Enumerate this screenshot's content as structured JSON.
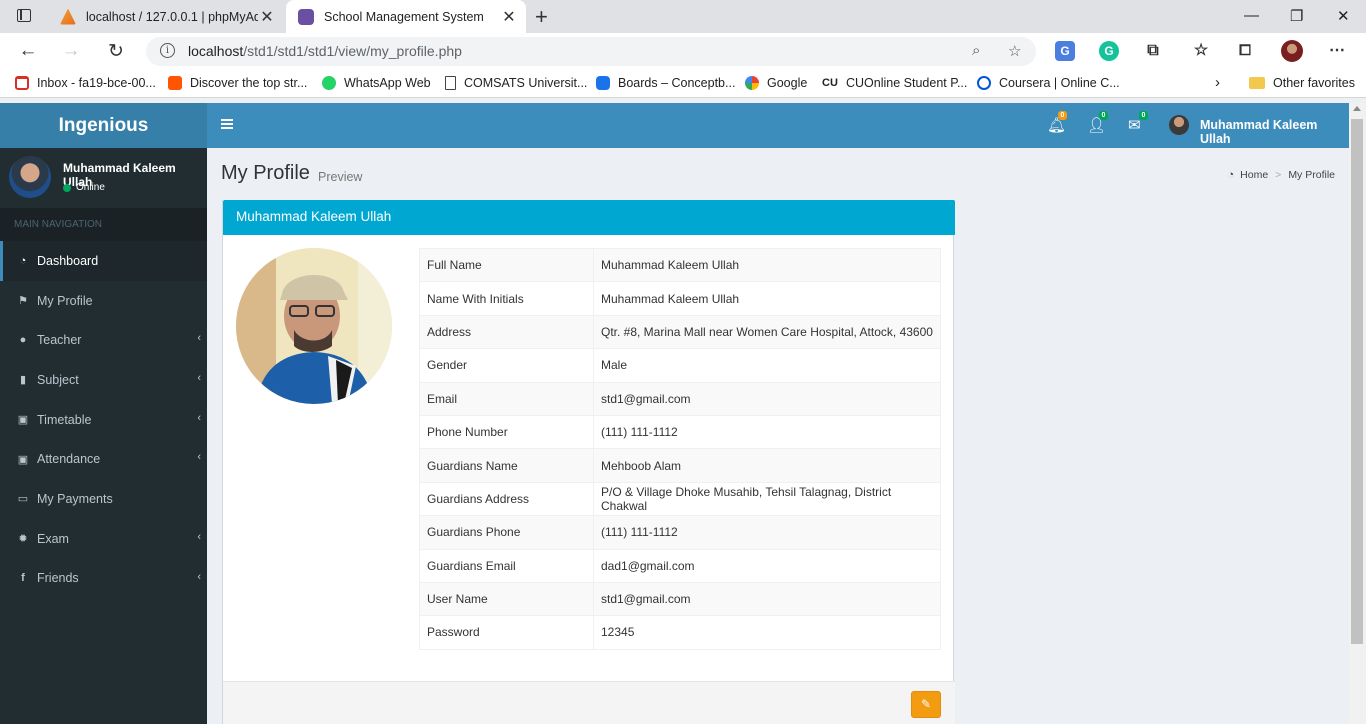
{
  "browser": {
    "tabs": [
      {
        "title": "localhost / 127.0.0.1 | phpMyAdmin",
        "active": false
      },
      {
        "title": "School Management System",
        "active": true
      }
    ],
    "url_host": "localhost",
    "url_path": "/std1/std1/std1/view/my_profile.php",
    "bookmarks": [
      {
        "label": "Inbox - fa19-bce-00...",
        "icon": "gmail-icon",
        "color": "#d93025"
      },
      {
        "label": "Discover the top str...",
        "icon": "soundcloud-icon",
        "color": "#ff5500"
      },
      {
        "label": "WhatsApp Web",
        "icon": "whatsapp-icon",
        "color": "#25d366"
      },
      {
        "label": "COMSATS Universit...",
        "icon": "page-icon",
        "color": "#ffffff"
      },
      {
        "label": "Boards – Conceptb...",
        "icon": "conceptboard-icon",
        "color": "#1a73e8"
      },
      {
        "label": "Google",
        "icon": "google-icon",
        "color": "#4285f4"
      },
      {
        "label": "CUOnline Student P...",
        "icon": "cu-icon",
        "color": "#222222"
      },
      {
        "label": "Coursera | Online C...",
        "icon": "coursera-icon",
        "color": "#0056d2"
      }
    ],
    "other_favorites": "Other favorites"
  },
  "app": {
    "brand": "Ingenious",
    "header": {
      "notifications_count": "0",
      "friend_requests_count": "0",
      "messages_count": "0",
      "user_name": "Muhammad Kaleem Ullah"
    },
    "sidebar": {
      "user_name": "Muhammad Kaleem Ullah",
      "status": "Online",
      "nav_header": "MAIN NAVIGATION",
      "items": [
        {
          "label": "Dashboard",
          "icon": "dashboard-icon",
          "active": true,
          "has_children": false
        },
        {
          "label": "My Profile",
          "icon": "flag-icon",
          "active": false,
          "has_children": false
        },
        {
          "label": "Teacher",
          "icon": "user-icon",
          "active": false,
          "has_children": true
        },
        {
          "label": "Subject",
          "icon": "book-icon",
          "active": false,
          "has_children": true
        },
        {
          "label": "Timetable",
          "icon": "calendar-plus-icon",
          "active": false,
          "has_children": true
        },
        {
          "label": "Attendance",
          "icon": "calendar-check-icon",
          "active": false,
          "has_children": true
        },
        {
          "label": "My Payments",
          "icon": "money-icon",
          "active": false,
          "has_children": false
        },
        {
          "label": "Exam",
          "icon": "gear-icon",
          "active": false,
          "has_children": true
        },
        {
          "label": "Friends",
          "icon": "facebook-icon",
          "active": false,
          "has_children": true
        }
      ]
    },
    "page": {
      "title": "My Profile",
      "subtitle": "Preview",
      "breadcrumb": [
        "Home",
        "My Profile"
      ]
    },
    "profile": {
      "box_title": "Muhammad Kaleem Ullah",
      "rows": [
        {
          "label": "Full Name",
          "value": "Muhammad Kaleem Ullah"
        },
        {
          "label": "Name With Initials",
          "value": "Muhammad Kaleem Ullah"
        },
        {
          "label": "Address",
          "value": "Qtr. #8, Marina Mall near Women Care Hospital, Attock, 43600"
        },
        {
          "label": "Gender",
          "value": "Male"
        },
        {
          "label": "Email",
          "value": "std1@gmail.com"
        },
        {
          "label": "Phone Number",
          "value": "(111) 111-1112"
        },
        {
          "label": "Guardians Name",
          "value": "Mehboob Alam"
        },
        {
          "label": "Guardians Address",
          "value": "P/O & Village Dhoke Musahib, Tehsil Talagnag, District Chakwal"
        },
        {
          "label": "Guardians Phone",
          "value": "(111) 111-1112"
        },
        {
          "label": "Guardians Email",
          "value": "dad1@gmail.com"
        },
        {
          "label": "User Name",
          "value": "std1@gmail.com"
        },
        {
          "label": "Password",
          "value": "12345"
        }
      ],
      "edit_icon": "edit-icon"
    },
    "colors": {
      "header": "#3c8dbc",
      "logo": "#367fa9",
      "sidebar": "#222d32",
      "box_header": "#00a7d0",
      "edit_button": "#f39c12",
      "online": "#00a65a"
    }
  }
}
